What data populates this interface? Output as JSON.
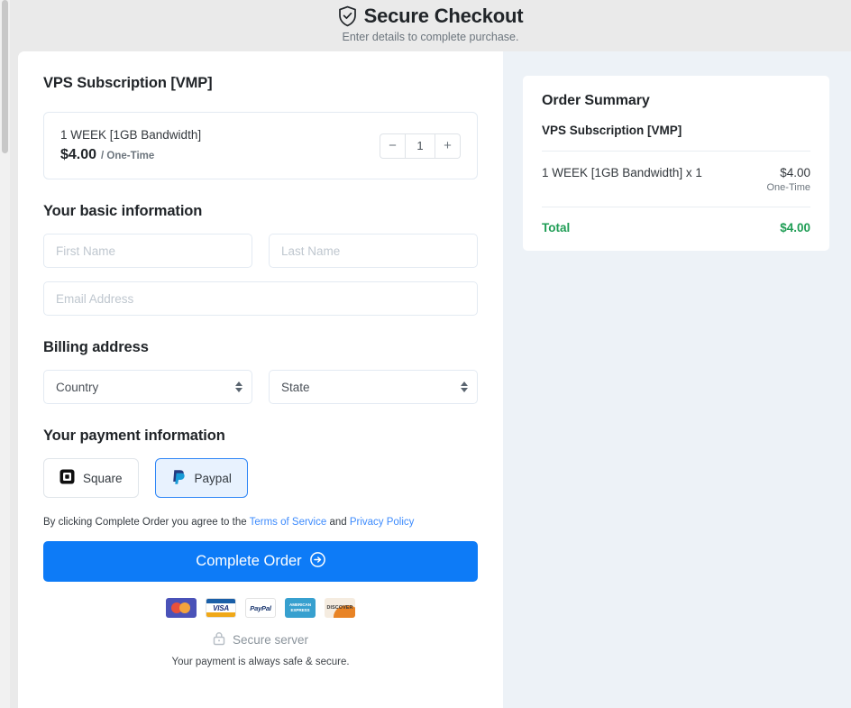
{
  "header": {
    "icon": "shield-check-icon",
    "title": "Secure Checkout",
    "subtitle": "Enter details to complete purchase."
  },
  "product": {
    "heading": "VPS Subscription [VMP]",
    "name": "1 WEEK [1GB Bandwidth]",
    "price": "$4.00",
    "period": "/ One-Time",
    "quantity": "1",
    "minus_label": "−",
    "plus_label": "+"
  },
  "basic_info": {
    "heading": "Your basic information",
    "first_name_placeholder": "First Name",
    "last_name_placeholder": "Last Name",
    "email_placeholder": "Email Address",
    "first_name_value": "",
    "last_name_value": "",
    "email_value": ""
  },
  "billing": {
    "heading": "Billing address",
    "country_selected": "Country",
    "state_selected": "State"
  },
  "payment": {
    "heading": "Your payment information",
    "methods": [
      {
        "label": "Square",
        "icon": "square-icon",
        "selected": false
      },
      {
        "label": "Paypal",
        "icon": "paypal-icon",
        "selected": true
      }
    ]
  },
  "terms": {
    "prefix": "By clicking Complete Order you agree to the ",
    "tos_link": "Terms of Service",
    "middle": " and ",
    "privacy_link": "Privacy Policy"
  },
  "cta": {
    "label": "Complete Order",
    "icon": "arrow-right-circle-icon",
    "color": "#0d7bf7"
  },
  "card_logos": [
    {
      "name": "mastercard-logo",
      "text": ""
    },
    {
      "name": "visa-logo",
      "text": "VISA"
    },
    {
      "name": "paypal-logo",
      "text": "PayPal"
    },
    {
      "name": "amex-logo",
      "text": "AMERICAN EXPRESS"
    },
    {
      "name": "discover-logo",
      "text": "DISCOVER"
    }
  ],
  "footer": {
    "secure_icon": "lock-icon",
    "secure_label": "Secure server",
    "note": "Your payment is always safe & secure."
  },
  "summary": {
    "title": "Order Summary",
    "product": "VPS Subscription [VMP]",
    "line_name": "1 WEEK [1GB Bandwidth] x 1",
    "line_price": "$4.00",
    "line_period": "One-Time",
    "total_label": "Total",
    "total_value": "$4.00",
    "total_color": "#1f9d55"
  }
}
